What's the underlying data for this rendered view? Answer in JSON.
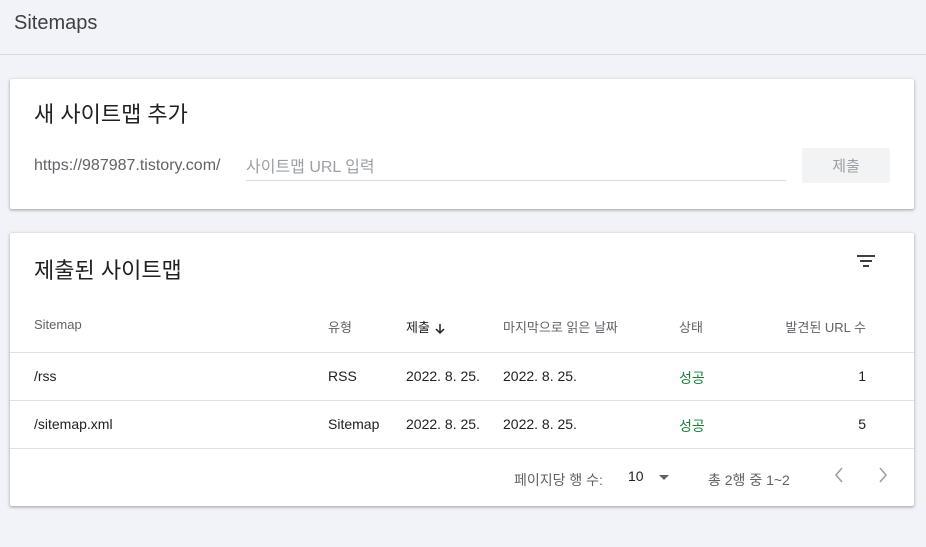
{
  "page": {
    "title": "Sitemaps"
  },
  "add_card": {
    "title": "새 사이트맵 추가",
    "url_prefix": "https://987987.tistory.com/",
    "input_placeholder": "사이트맵 URL 입력",
    "input_value": "",
    "submit_label": "제출"
  },
  "list_card": {
    "title": "제출된 사이트맵",
    "filter_icon": "filter-list-icon",
    "columns": [
      "Sitemap",
      "유형",
      "제출",
      "마지막으로 읽은 날짜",
      "상태",
      "발견된 URL 수"
    ],
    "sort_column": "제출",
    "sort_direction": "descending",
    "rows": [
      {
        "sitemap": "/rss",
        "type": "RSS",
        "submitted": "2022. 8. 25.",
        "last_read": "2022. 8. 25.",
        "status": "성공",
        "urls": "1"
      },
      {
        "sitemap": "/sitemap.xml",
        "type": "Sitemap",
        "submitted": "2022. 8. 25.",
        "last_read": "2022. 8. 25.",
        "status": "성공",
        "urls": "5"
      }
    ],
    "pagination": {
      "rows_per_page_label": "페이지당 행 수:",
      "rows_per_page": "10",
      "range_text": "총 2행 중 1~2"
    }
  },
  "colors": {
    "status_success": "#188038",
    "background": "#f1f3f9"
  }
}
